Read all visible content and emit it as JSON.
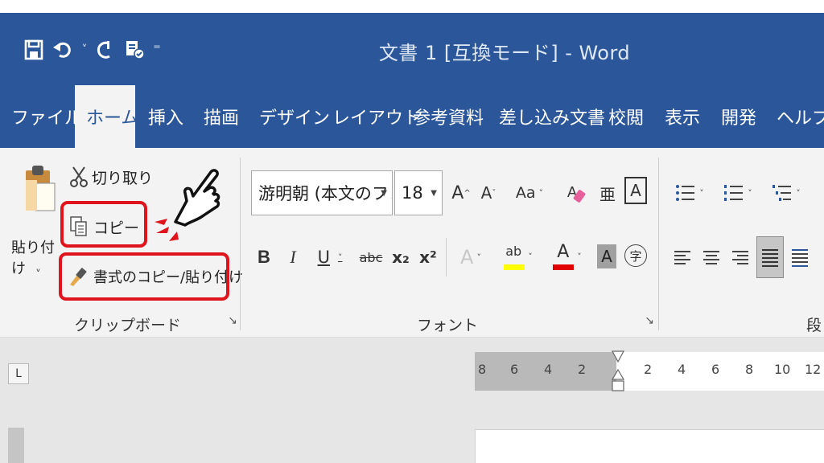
{
  "window": {
    "title": "文書 1 [互換モード]  -  Word"
  },
  "qat": {
    "items": [
      {
        "name": "save",
        "icon": "save-icon"
      },
      {
        "name": "undo",
        "icon": "undo-icon"
      },
      {
        "name": "undo-dropdown",
        "icon": "chevron-down-icon"
      },
      {
        "name": "redo",
        "icon": "redo-icon"
      },
      {
        "name": "check-accessibility",
        "icon": "accessibility-check-icon"
      },
      {
        "name": "customize",
        "icon": "customize-qat-icon"
      }
    ]
  },
  "tabs": [
    {
      "label": "ファイル"
    },
    {
      "label": "ホーム",
      "active": true
    },
    {
      "label": "挿入"
    },
    {
      "label": "描画"
    },
    {
      "label": "デザイン"
    },
    {
      "label": "レイアウト"
    },
    {
      "label": "参考資料"
    },
    {
      "label": "差し込み文書"
    },
    {
      "label": "校閲"
    },
    {
      "label": "表示"
    },
    {
      "label": "開発"
    },
    {
      "label": "ヘルプ"
    }
  ],
  "clipboard": {
    "group_label": "クリップボード",
    "paste_label": "貼り付け",
    "cut_label": "切り取り",
    "copy_label": "コピー",
    "format_painter_label": "書式のコピー/貼り付け"
  },
  "font": {
    "group_label": "フォント",
    "font_name": "游明朝 (本文のフォン",
    "font_size": "18",
    "grow_label": "A",
    "shrink_label": "A",
    "case_label": "Aa",
    "bold_label": "B",
    "italic_label": "I",
    "underline_label": "U",
    "strike_label": "abc",
    "subscript_label": "x₂",
    "superscript_label": "x²",
    "effects_label": "A",
    "highlight_label": "ab",
    "font_color_label": "A",
    "shading_label": "A",
    "enclose_label": "字",
    "boxed_label": "A",
    "phonetic_label": "亜"
  },
  "paragraph": {
    "group_label": "段"
  },
  "ruler": {
    "ticks": [
      "8",
      "6",
      "4",
      "2",
      "2",
      "4",
      "6",
      "8",
      "10",
      "12"
    ],
    "tab_selector": "L"
  },
  "colors": {
    "word_blue": "#2b579a",
    "ribbon_bg": "#f3f3f3",
    "highlight_red": "#e0141c",
    "highlight_yellow": "#ffff00",
    "font_red": "#e00000"
  }
}
